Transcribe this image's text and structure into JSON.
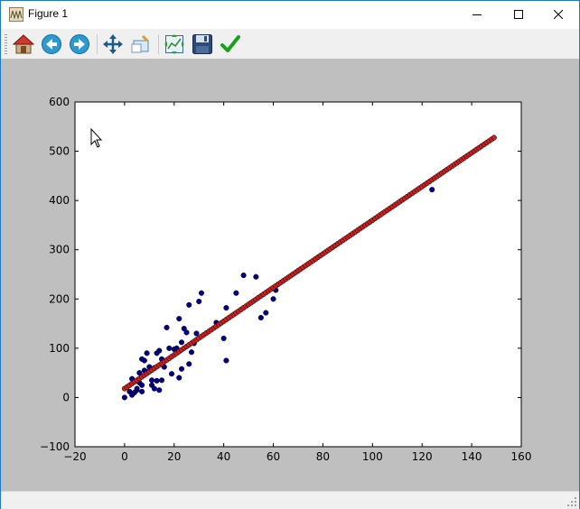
{
  "window": {
    "title": "Figure 1",
    "controls": {
      "minimize": "minimize",
      "maximize": "maximize",
      "close": "close"
    }
  },
  "toolbar": {
    "buttons": [
      {
        "name": "home",
        "icon": "home-icon"
      },
      {
        "name": "back",
        "icon": "back-arrow-icon"
      },
      {
        "name": "forward",
        "icon": "forward-arrow-icon"
      },
      {
        "name": "pan",
        "icon": "pan-move-icon"
      },
      {
        "name": "zoom",
        "icon": "zoom-rect-icon"
      },
      {
        "name": "configure-subplots",
        "icon": "subplots-icon"
      },
      {
        "name": "save",
        "icon": "floppy-disk-icon"
      },
      {
        "name": "edit-axis",
        "icon": "checkmark-icon"
      }
    ]
  },
  "colors": {
    "figure_bg": "#bfbfbf",
    "axes_bg": "#ffffff",
    "scatter_blue": "#00008b",
    "line_red": "#cc2020"
  },
  "chart_data": {
    "type": "scatter",
    "title": "",
    "xlabel": "",
    "ylabel": "",
    "xlim": [
      -20,
      160
    ],
    "ylim": [
      -100,
      600
    ],
    "xticks": [
      -20,
      0,
      20,
      40,
      60,
      80,
      100,
      120,
      140,
      160
    ],
    "yticks": [
      -100,
      0,
      100,
      200,
      300,
      400,
      500,
      600
    ],
    "grid": false,
    "series": [
      {
        "role": "observed",
        "color": "#00008b",
        "points": [
          [
            0,
            0
          ],
          [
            2,
            12
          ],
          [
            3,
            5
          ],
          [
            3,
            38
          ],
          [
            4,
            10
          ],
          [
            5,
            15
          ],
          [
            5,
            18
          ],
          [
            6,
            30
          ],
          [
            6,
            50
          ],
          [
            7,
            12
          ],
          [
            7,
            25
          ],
          [
            7,
            78
          ],
          [
            8,
            55
          ],
          [
            8,
            75
          ],
          [
            9,
            52
          ],
          [
            9,
            90
          ],
          [
            10,
            62
          ],
          [
            11,
            25
          ],
          [
            11,
            35
          ],
          [
            12,
            18
          ],
          [
            12,
            60
          ],
          [
            13,
            34
          ],
          [
            13,
            90
          ],
          [
            14,
            15
          ],
          [
            14,
            95
          ],
          [
            15,
            35
          ],
          [
            15,
            78
          ],
          [
            16,
            62
          ],
          [
            17,
            142
          ],
          [
            18,
            100
          ],
          [
            19,
            48
          ],
          [
            20,
            98
          ],
          [
            21,
            100
          ],
          [
            22,
            160
          ],
          [
            22,
            40
          ],
          [
            23,
            58
          ],
          [
            23,
            112
          ],
          [
            24,
            140
          ],
          [
            25,
            132
          ],
          [
            26,
            68
          ],
          [
            26,
            188
          ],
          [
            27,
            92
          ],
          [
            28,
            110
          ],
          [
            29,
            130
          ],
          [
            30,
            195
          ],
          [
            31,
            212
          ],
          [
            37,
            152
          ],
          [
            40,
            120
          ],
          [
            41,
            75
          ],
          [
            41,
            182
          ],
          [
            45,
            212
          ],
          [
            48,
            248
          ],
          [
            53,
            245
          ],
          [
            55,
            162
          ],
          [
            57,
            172
          ],
          [
            60,
            200
          ],
          [
            61,
            218
          ],
          [
            124,
            422
          ]
        ]
      },
      {
        "role": "fitted",
        "color": "#cc2020",
        "intercept": 18,
        "slope": 3.42,
        "x_start": 0,
        "x_end": 149,
        "x_step": 1
      }
    ]
  }
}
